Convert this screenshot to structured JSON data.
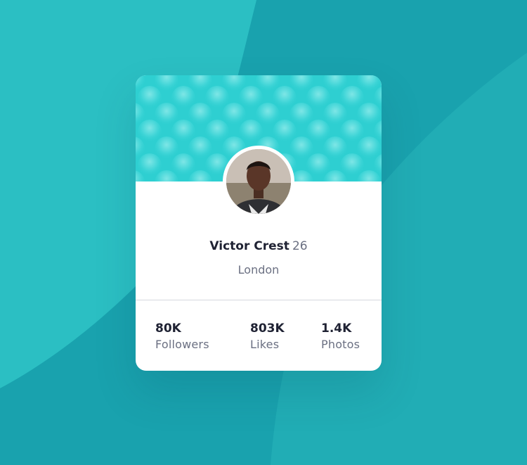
{
  "profile": {
    "name": "Victor Crest",
    "age": "26",
    "location": "London"
  },
  "stats": [
    {
      "value": "80K",
      "label": "Followers"
    },
    {
      "value": "803K",
      "label": "Likes"
    },
    {
      "value": "1.4K",
      "label": "Photos"
    }
  ],
  "colors": {
    "background": "#19a2ae",
    "background_light": "#2bbfc3",
    "header": "#2ecfd1",
    "text_dark": "#1f2233",
    "text_muted": "#6b7082",
    "card": "#ffffff"
  },
  "icons": {
    "avatar": "profile-photo",
    "header_pattern": "bubble-pattern"
  }
}
